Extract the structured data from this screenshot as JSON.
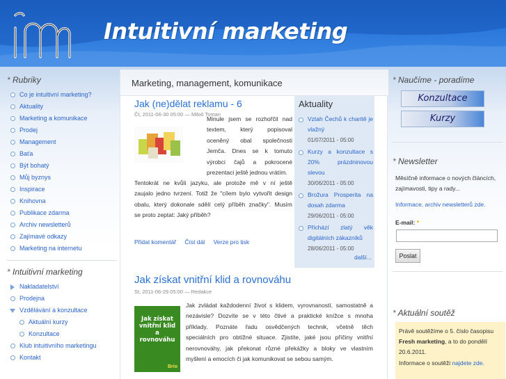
{
  "header": {
    "title": "Intuitivní marketing",
    "logo_text": "im"
  },
  "left": {
    "rubriky_title": "Rubriky",
    "rubriky": [
      "Co je intuitivní marketing?",
      "Aktuality",
      "Marketing a komunikace",
      "Prodej",
      "Management",
      "Baťa",
      "Být bohatý",
      "Můj byznys",
      "Inspirace",
      "Knihovna",
      "Publikace zdarma",
      "Archiv newsletterů",
      "Zajímavé odkazy",
      "Marketing na internetu"
    ],
    "im_title": "Intuitivní marketing",
    "im_items": [
      "Nakladatelství",
      "Prodejna",
      "Vzdělávání a konzultace",
      "Aktuální kurzy",
      "Konzultace",
      "Klub intuitivního marketingu",
      "Kontakt"
    ]
  },
  "main": {
    "title": "Marketing, management, komunikace",
    "article1": {
      "title": "Jak (ne)dělat reklamu - 6",
      "meta": "Čt, 2011-06-30 05:00 — Miloš Toman",
      "text_lines": [
        "Minule jsem se rozhořčil nad",
        "textem, který popisoval",
        "oceněný obal společnosti",
        "Jemča. Dnes se k tomuto",
        "výrobci čajů a pokrocené",
        "prezentaci ještě jednou vrátím."
      ],
      "text_full": [
        "Tentokrát ne kvůli jazyku, ale protože mě v ní ještě",
        "zaujalo jedno tvrzení. Totiž že \"cílem bylo vytvořit design",
        "obalu, který dokonale sdělí celý příběh značky\". Musím",
        "se proto zeptat: Jaký příběh?"
      ],
      "links": [
        "Přidat komentář",
        "Číst dál",
        "Verze pro tisk"
      ]
    },
    "article2": {
      "title": "Jak získat vnitřní klid a rovnováhu",
      "meta": "St, 2011-06-29 05:00 — Redakce",
      "text_lines": [
        "Jak zvládat každodenní život s klidem, vyrovnaností, samostatně a",
        "nezávisle? Dozvíte se v této čtivé a praktické knížce s mnoha",
        "příklady. Poznáte řadu osvědčených technik, včetně těch",
        "speciálních pro obtížné situace. Zjistíte, jaké jsou příčiny vnitřní",
        "nerovnováhy, jak překonat různé překážky a bloky ve vlastním",
        "myšlení a emocích či jak komunikovat se sebou samým."
      ],
      "book_title": "Jak získat vnitřní klid a rovnováhu",
      "book_publisher": "Brio"
    }
  },
  "aktuality": {
    "title": "Aktuality",
    "items": [
      {
        "text": "Vztah Čechů k charitě je vlažný",
        "date": "01/07/2011 - 05:00"
      },
      {
        "text": "Kurzy a konzultace s 20% prázdninovou slevou",
        "date": "30/06/2011 - 05:00"
      },
      {
        "text": "Brožura Prosperita na dosah zdarma",
        "date": "29/06/2011 - 05:00"
      },
      {
        "text": "Přichází zlatý věk digitálních zákazníků",
        "date": "28/06/2011 - 05:00"
      }
    ],
    "more": "další..."
  },
  "right": {
    "naucime_title": "Naučíme - poradíme",
    "btn_konzultace": "Konzultace",
    "btn_kurzy": "Kurzy",
    "newsletter_title": "Newsletter",
    "newsletter_text": "Měsíčně informace o nových článcích, zajímavosti, tipy a rady...",
    "newsletter_link": "Informace, archiv newsletterů zde.",
    "email_label": "E-mail:",
    "required_mark": "*",
    "send_label": "Poslat",
    "contest_title": "Aktuální soutěž",
    "contest_text_1": "Právě soutěžíme o 5. číslo časopisu ",
    "contest_bold": "Fresh marketing",
    "contest_text_2": ", a to do pondělí 20.6.2011.",
    "contest_text_3": "Informace o soutěži ",
    "contest_link": "najdete zde."
  },
  "colors": {
    "header_blue": "#2a78db",
    "link_blue": "#2a63c8",
    "title_blue": "#2a6fd3",
    "aktuality_bg": "#dfe9f6",
    "contest_bg": "#fdf2c8"
  }
}
